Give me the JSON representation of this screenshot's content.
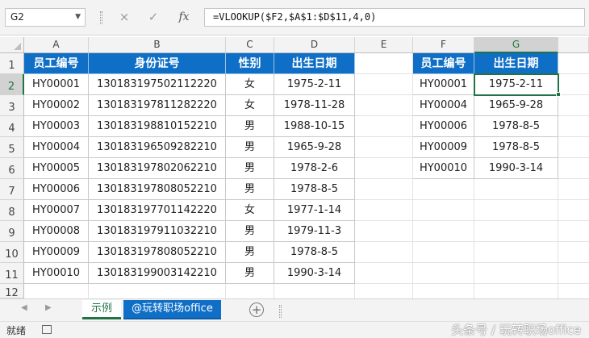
{
  "name_box": "G2",
  "formula_bar": {
    "cancel_icon": "×",
    "enter_icon": "✓",
    "fx_label": "fx",
    "formula": "=VLOOKUP($F2,$A$1:$D$11,4,0)"
  },
  "columns": [
    "A",
    "B",
    "C",
    "D",
    "E",
    "F",
    "G"
  ],
  "rows": [
    "1",
    "2",
    "3",
    "4",
    "5",
    "6",
    "7",
    "8",
    "9",
    "10",
    "11",
    "12"
  ],
  "left_table": {
    "headers": [
      "员工编号",
      "身份证号",
      "性别",
      "出生日期"
    ],
    "rows": [
      [
        "HY00001",
        "130183197502112220",
        "女",
        "1975-2-11"
      ],
      [
        "HY00002",
        "130183197811282220",
        "女",
        "1978-11-28"
      ],
      [
        "HY00003",
        "130183198810152210",
        "男",
        "1988-10-15"
      ],
      [
        "HY00004",
        "130183196509282210",
        "男",
        "1965-9-28"
      ],
      [
        "HY00005",
        "130183197802062210",
        "男",
        "1978-2-6"
      ],
      [
        "HY00006",
        "130183197808052210",
        "男",
        "1978-8-5"
      ],
      [
        "HY00007",
        "130183197701142220",
        "女",
        "1977-1-14"
      ],
      [
        "HY00008",
        "130183197911032210",
        "男",
        "1979-11-3"
      ],
      [
        "HY00009",
        "130183197808052210",
        "男",
        "1978-8-5"
      ],
      [
        "HY00010",
        "130183199003142210",
        "男",
        "1990-3-14"
      ]
    ]
  },
  "right_table": {
    "headers": [
      "员工编号",
      "出生日期"
    ],
    "rows": [
      [
        "HY00001",
        "1975-2-11"
      ],
      [
        "HY00004",
        "1965-9-28"
      ],
      [
        "HY00006",
        "1978-8-5"
      ],
      [
        "HY00009",
        "1978-8-5"
      ],
      [
        "HY00010",
        "1990-3-14"
      ]
    ]
  },
  "sheet_tabs": [
    "示例",
    "@玩转职场office"
  ],
  "add_sheet_icon": "+",
  "status": "就绪",
  "watermark": "头条号 / 玩转职场office",
  "colors": {
    "header_blue": "#0f6fc6",
    "excel_green": "#217346"
  }
}
